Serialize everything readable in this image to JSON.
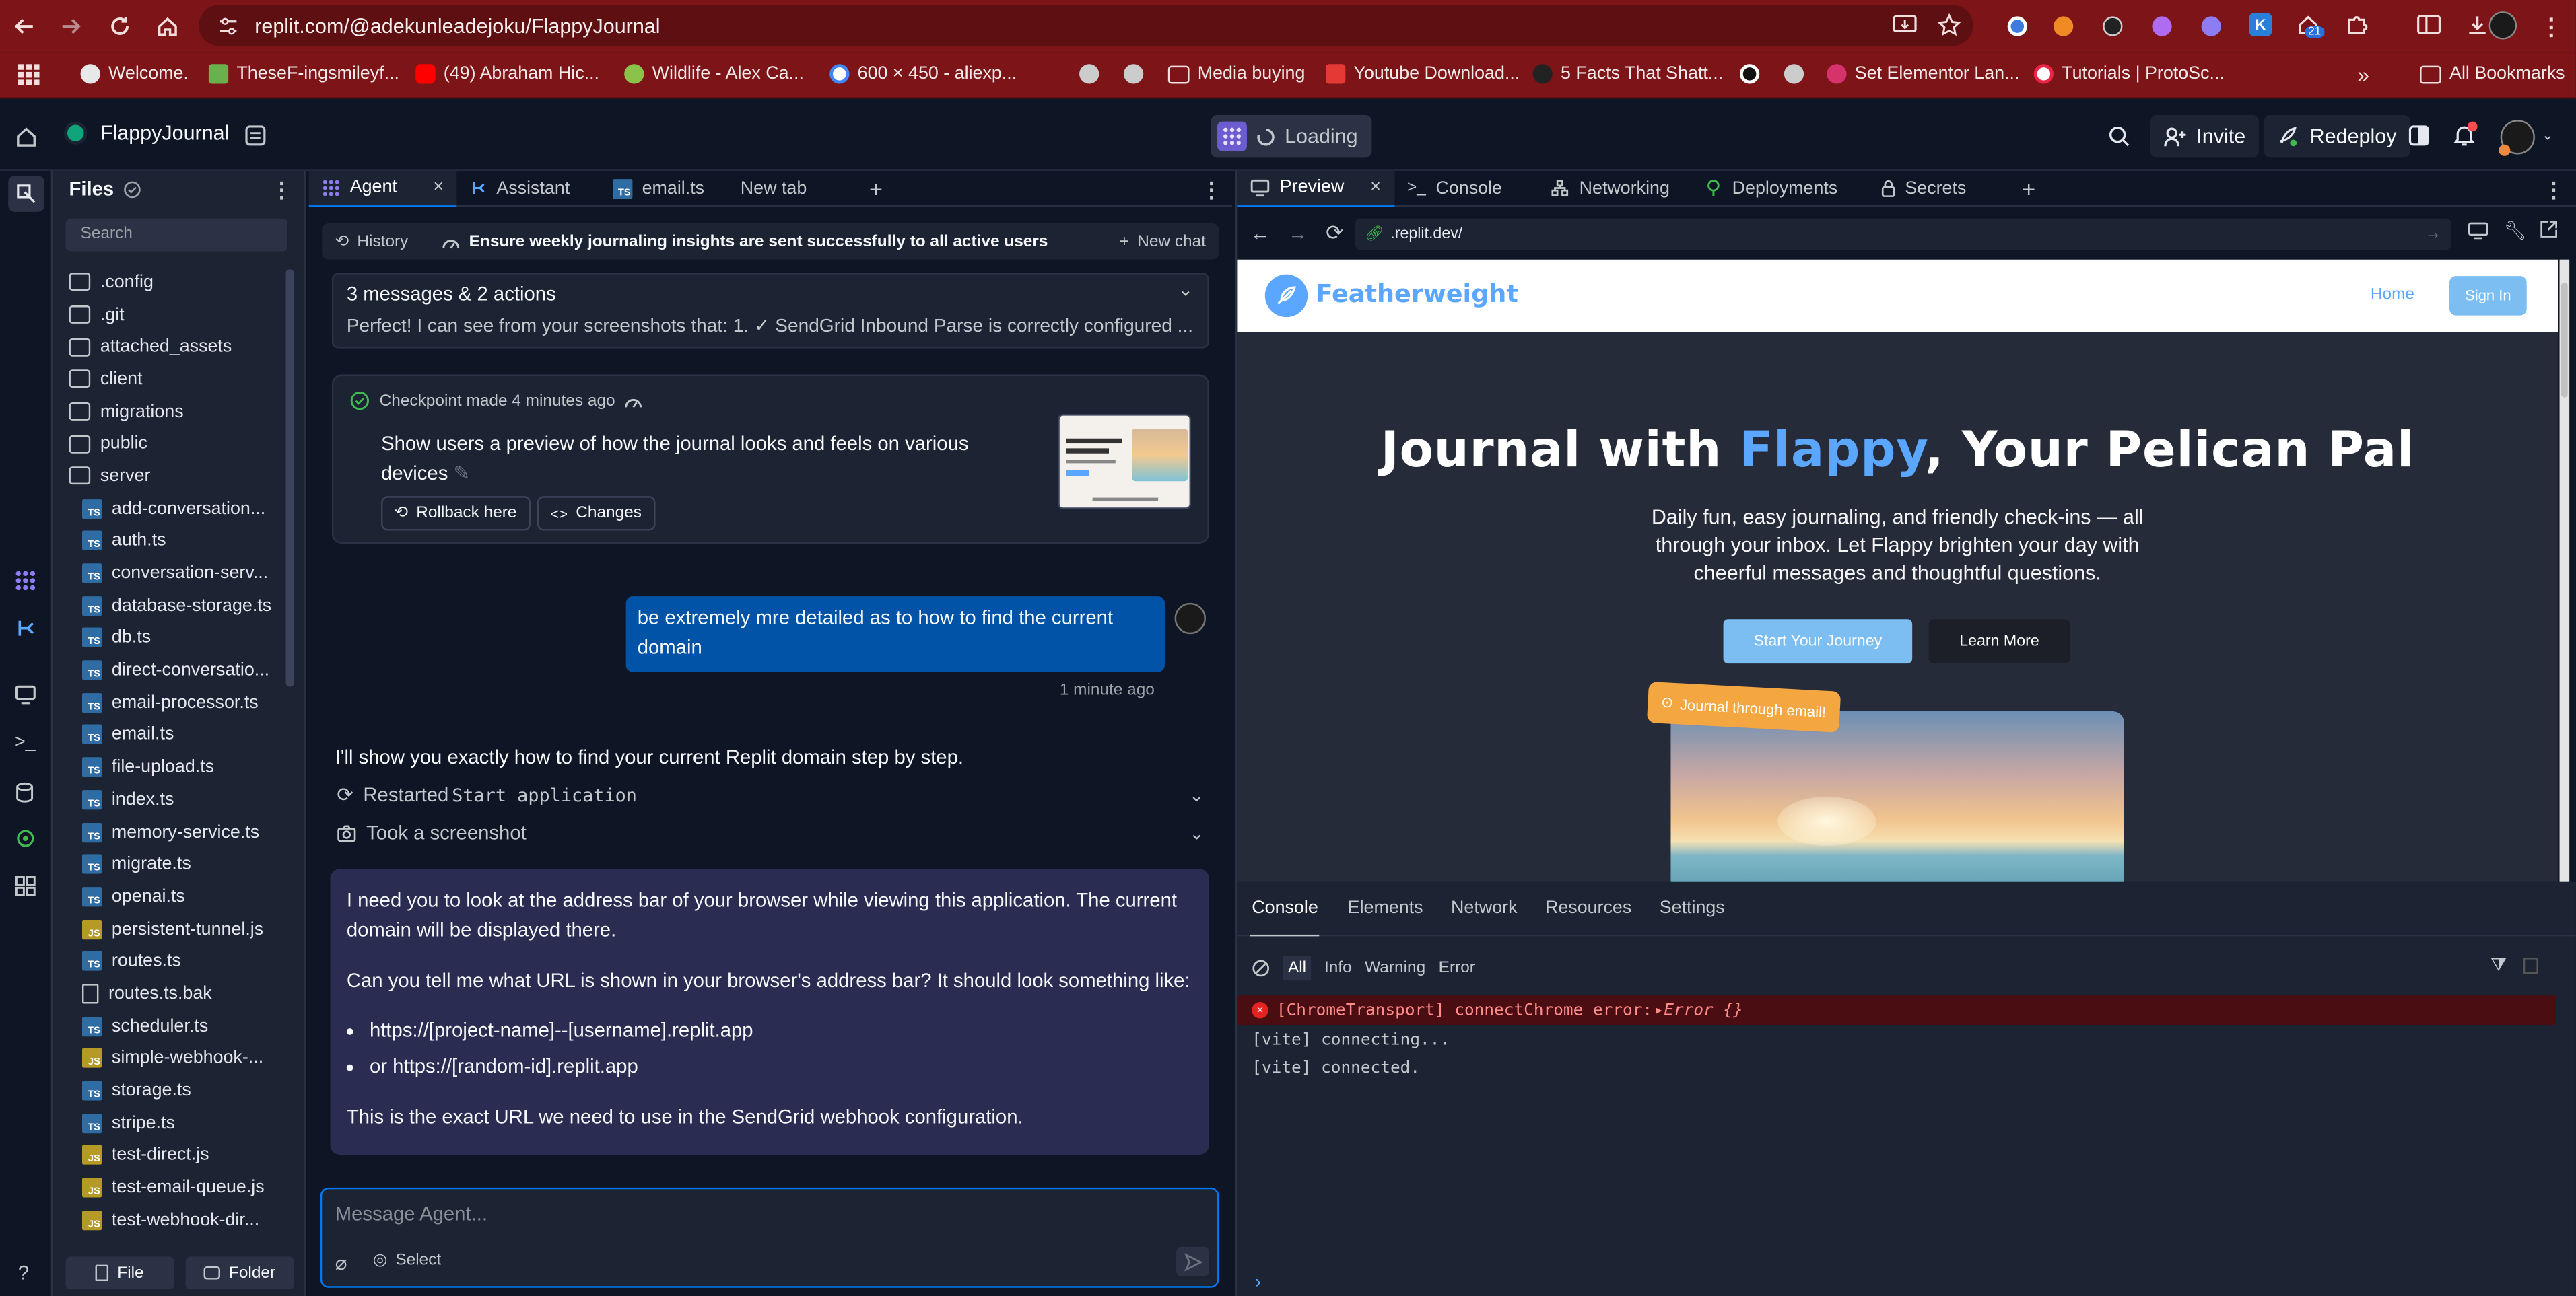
{
  "browser": {
    "url": "replit.com/@adekunleadejoku/FlappyJournal",
    "bookmarks": [
      "Welcome.",
      "TheseF-ingsmileyf...",
      "(49) Abraham Hic...",
      "Wildlife - Alex Ca...",
      "600 × 450 - aliexp...",
      "Media buying",
      "Youtube Download...",
      "5 Facts That Shatt...",
      "Set Elementor Lan...",
      "Tutorials | ProtoSc..."
    ],
    "all_bookmarks": "All Bookmarks",
    "ext_badge": "21"
  },
  "header": {
    "project": "FlappyJournal",
    "status": "Loading",
    "invite": "Invite",
    "redeploy": "Redeploy"
  },
  "files": {
    "title": "Files",
    "search_placeholder": "Search",
    "items": [
      {
        "name": ".config",
        "kind": "folder"
      },
      {
        "name": ".git",
        "kind": "folder"
      },
      {
        "name": "attached_assets",
        "kind": "folder"
      },
      {
        "name": "client",
        "kind": "folder"
      },
      {
        "name": "migrations",
        "kind": "folder"
      },
      {
        "name": "public",
        "kind": "folder"
      },
      {
        "name": "server",
        "kind": "folder-open"
      },
      {
        "name": "add-conversation...",
        "kind": "ts"
      },
      {
        "name": "auth.ts",
        "kind": "ts"
      },
      {
        "name": "conversation-serv...",
        "kind": "ts"
      },
      {
        "name": "database-storage.ts",
        "kind": "ts"
      },
      {
        "name": "db.ts",
        "kind": "ts"
      },
      {
        "name": "direct-conversatio...",
        "kind": "ts"
      },
      {
        "name": "email-processor.ts",
        "kind": "ts"
      },
      {
        "name": "email.ts",
        "kind": "ts"
      },
      {
        "name": "file-upload.ts",
        "kind": "ts"
      },
      {
        "name": "index.ts",
        "kind": "ts"
      },
      {
        "name": "memory-service.ts",
        "kind": "ts"
      },
      {
        "name": "migrate.ts",
        "kind": "ts"
      },
      {
        "name": "openai.ts",
        "kind": "ts"
      },
      {
        "name": "persistent-tunnel.js",
        "kind": "js"
      },
      {
        "name": "routes.ts",
        "kind": "ts"
      },
      {
        "name": "routes.ts.bak",
        "kind": "file"
      },
      {
        "name": "scheduler.ts",
        "kind": "ts"
      },
      {
        "name": "simple-webhook-...",
        "kind": "js"
      },
      {
        "name": "storage.ts",
        "kind": "ts"
      },
      {
        "name": "stripe.ts",
        "kind": "ts"
      },
      {
        "name": "test-direct.js",
        "kind": "js"
      },
      {
        "name": "test-email-queue.js",
        "kind": "js"
      },
      {
        "name": "test-webhook-dir...",
        "kind": "js"
      }
    ],
    "new_file": "File",
    "new_folder": "Folder"
  },
  "agent": {
    "tabs": [
      "Agent",
      "Assistant",
      "email.ts",
      "New tab"
    ],
    "history": "History",
    "thread_title": "Ensure weekly journaling insights are sent successfully to all active users",
    "new_chat": "New chat",
    "summary_title": "3 messages & 2 actions",
    "summary_text": "Perfect! I can see from your screenshots that: 1. ✓ SendGrid Inbound Parse is correctly configured ...",
    "checkpoint_label": "Checkpoint made 4 minutes ago",
    "checkpoint_text": "Show users a preview of how the journal looks and feels on various devices",
    "rollback": "Rollback here",
    "changes": "Changes",
    "user_msg": "be extremely mre detailed as to how to find the current domain",
    "user_time": "1 minute ago",
    "reply_intro": "I'll show you exactly how to find your current Replit domain step by step.",
    "action1_a": "Restarted ",
    "action1_b": "Start application",
    "action2": "Took a screenshot",
    "reply_p1": "I need you to look at the address bar of your browser while viewing this application. The current domain will be displayed there.",
    "reply_p2": "Can you tell me what URL is shown in your browser's address bar? It should look something like:",
    "bullet1": "https://[project-name]--[username].replit.app",
    "bullet2": "or https://[random-id].replit.app",
    "reply_p3": "This is the exact URL we need to use in the SendGrid webhook configuration.",
    "input_placeholder": "Message Agent...",
    "select": "Select"
  },
  "preview": {
    "tabs": [
      "Preview",
      "Console",
      "Networking",
      "Deployments",
      "Secrets"
    ],
    "url": ".replit.dev/",
    "site": {
      "brand": "Featherweight",
      "nav_home": "Home",
      "nav_signin": "Sign In",
      "hero_a": "Journal with ",
      "hero_b": "Flappy",
      "hero_c": ", Your Pelican Pal",
      "sub": "Daily fun, easy journaling, and friendly check-ins — all through your inbox. Let Flappy brighten your day with cheerful messages and thoughtful questions.",
      "cta1": "Start Your Journey",
      "cta2": "Learn More",
      "badge": "Journal through email!"
    },
    "devtools": {
      "tabs": [
        "Console",
        "Elements",
        "Network",
        "Resources",
        "Settings"
      ],
      "filters": [
        "All",
        "Info",
        "Warning",
        "Error"
      ],
      "error": "[ChromeTransport] connectChrome error: ",
      "error_obj": "Error {}",
      "log1": "[vite] connecting...",
      "log2": "[vite] connected."
    }
  },
  "colors": {
    "accent": "#5ba7ff",
    "user_bubble": "#0053a6",
    "error": "#e52222",
    "chrome": "#7d1418"
  }
}
